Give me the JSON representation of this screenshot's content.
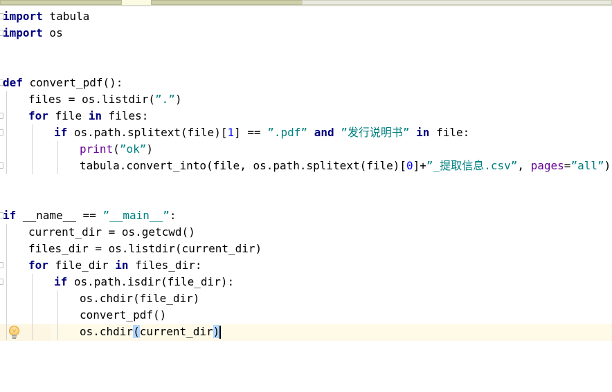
{
  "window": {
    "type": "code-editor",
    "language": "Python"
  },
  "scrollbar": {
    "orientation": "horizontal",
    "position": "top"
  },
  "gutter": {
    "bulb_icon": "lightbulb-icon",
    "fold_marker_icon": "fold-marker-icon"
  },
  "editor": {
    "font_size_px": 16,
    "line_height_px": 24,
    "background": "#ffffff",
    "current_line_background": "#fffae8",
    "indent_guide_color": "#d3d3d3",
    "caret_color": "#000000",
    "bracket_match_background": "#b4d7ff",
    "colors": {
      "keyword": "#000080",
      "string": "#008080",
      "number": "#0000ff",
      "builtin": "#660099",
      "keyword_argument": "#660099",
      "plain": "#000000"
    },
    "current_line_number": 18,
    "lines": [
      {
        "n": 1,
        "indent": 0,
        "fold": true,
        "tokens": [
          {
            "t": "import",
            "c": "kw"
          },
          {
            "t": " tabula",
            "c": "pln"
          }
        ]
      },
      {
        "n": 2,
        "indent": 0,
        "fold": true,
        "tokens": [
          {
            "t": "import",
            "c": "kw"
          },
          {
            "t": " os",
            "c": "pln"
          }
        ]
      },
      {
        "n": 3,
        "indent": 0,
        "fold": false,
        "tokens": []
      },
      {
        "n": 4,
        "indent": 0,
        "fold": false,
        "tokens": []
      },
      {
        "n": 5,
        "indent": 0,
        "fold": true,
        "tokens": [
          {
            "t": "def",
            "c": "kw"
          },
          {
            "t": " convert_pdf():",
            "c": "pln"
          }
        ]
      },
      {
        "n": 6,
        "indent": 1,
        "fold": false,
        "tokens": [
          {
            "t": "files = os.listdir(",
            "c": "pln"
          },
          {
            "t": "”.”",
            "c": "str"
          },
          {
            "t": ")",
            "c": "pln"
          }
        ]
      },
      {
        "n": 7,
        "indent": 1,
        "fold": true,
        "tokens": [
          {
            "t": "for",
            "c": "kw"
          },
          {
            "t": " file ",
            "c": "pln"
          },
          {
            "t": "in",
            "c": "kw"
          },
          {
            "t": " files:",
            "c": "pln"
          }
        ]
      },
      {
        "n": 8,
        "indent": 2,
        "fold": true,
        "tokens": [
          {
            "t": "if",
            "c": "kw"
          },
          {
            "t": " os.path.splitext(file)[",
            "c": "pln"
          },
          {
            "t": "1",
            "c": "num"
          },
          {
            "t": "] == ",
            "c": "pln"
          },
          {
            "t": "”.pdf”",
            "c": "str"
          },
          {
            "t": " ",
            "c": "pln"
          },
          {
            "t": "and",
            "c": "kw"
          },
          {
            "t": " ",
            "c": "pln"
          },
          {
            "t": "”发行说明书”",
            "c": "str"
          },
          {
            "t": " ",
            "c": "pln"
          },
          {
            "t": "in",
            "c": "kw"
          },
          {
            "t": " file:",
            "c": "pln"
          }
        ]
      },
      {
        "n": 9,
        "indent": 3,
        "fold": false,
        "tokens": [
          {
            "t": "print",
            "c": "bi"
          },
          {
            "t": "(",
            "c": "pln"
          },
          {
            "t": "”ok”",
            "c": "str"
          },
          {
            "t": ")",
            "c": "pln"
          }
        ]
      },
      {
        "n": 10,
        "indent": 3,
        "fold": true,
        "tokens": [
          {
            "t": "tabula.convert_into(file, os.path.splitext(file)[",
            "c": "pln"
          },
          {
            "t": "0",
            "c": "num"
          },
          {
            "t": "]+",
            "c": "pln"
          },
          {
            "t": "”_提取信息.csv”",
            "c": "str"
          },
          {
            "t": ", ",
            "c": "pln"
          },
          {
            "t": "pages",
            "c": "kwarg"
          },
          {
            "t": "=",
            "c": "pln"
          },
          {
            "t": "”all”",
            "c": "str"
          },
          {
            "t": ")",
            "c": "pln"
          }
        ]
      },
      {
        "n": 11,
        "indent": 0,
        "fold": false,
        "tokens": []
      },
      {
        "n": 12,
        "indent": 0,
        "fold": false,
        "tokens": []
      },
      {
        "n": 13,
        "indent": 0,
        "fold": true,
        "tokens": [
          {
            "t": "if",
            "c": "kw"
          },
          {
            "t": " __name__ == ",
            "c": "pln"
          },
          {
            "t": "”__main__”",
            "c": "str"
          },
          {
            "t": ":",
            "c": "pln"
          }
        ]
      },
      {
        "n": 14,
        "indent": 1,
        "fold": false,
        "tokens": [
          {
            "t": "current_dir = os.getcwd()",
            "c": "pln"
          }
        ]
      },
      {
        "n": 15,
        "indent": 1,
        "fold": false,
        "tokens": [
          {
            "t": "files_dir = os.listdir(current_dir)",
            "c": "pln"
          }
        ]
      },
      {
        "n": 16,
        "indent": 1,
        "fold": true,
        "tokens": [
          {
            "t": "for",
            "c": "kw"
          },
          {
            "t": " file_dir ",
            "c": "pln"
          },
          {
            "t": "in",
            "c": "kw"
          },
          {
            "t": " files_dir:",
            "c": "pln"
          }
        ]
      },
      {
        "n": 17,
        "indent": 2,
        "fold": true,
        "tokens": [
          {
            "t": "if",
            "c": "kw"
          },
          {
            "t": " os.path.isdir(file_dir):",
            "c": "pln"
          }
        ]
      },
      {
        "n": 18,
        "indent": 3,
        "fold": false,
        "tokens": [
          {
            "t": "os.chdir(file_dir)",
            "c": "pln"
          }
        ]
      },
      {
        "n": 19,
        "indent": 3,
        "fold": false,
        "tokens": [
          {
            "t": "convert_pdf()",
            "c": "pln"
          }
        ]
      },
      {
        "n": 20,
        "indent": 3,
        "fold": true,
        "caret": true,
        "tokens": [
          {
            "t": "os.chdir",
            "c": "pln"
          },
          {
            "t": "(",
            "c": "pln",
            "match": true
          },
          {
            "t": "current_dir",
            "c": "pln"
          },
          {
            "t": ")",
            "c": "pln",
            "match": true
          }
        ]
      }
    ]
  }
}
